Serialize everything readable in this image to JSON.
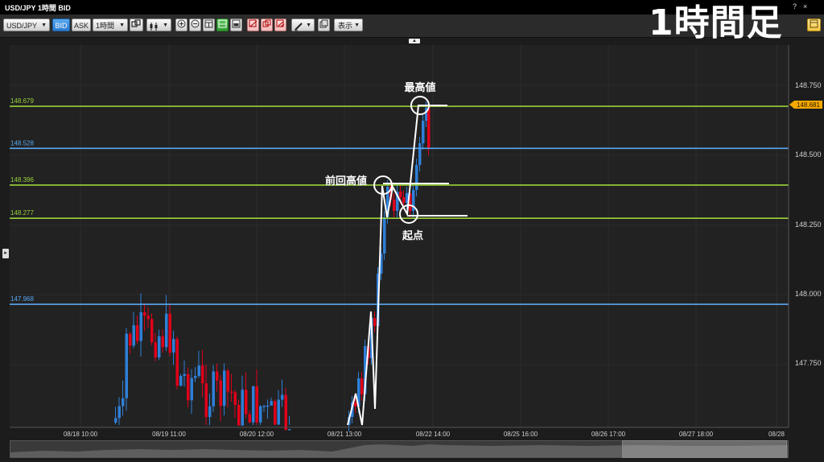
{
  "app": {
    "title": "USD/JPY 1時間 BID",
    "help": "?",
    "close": "×"
  },
  "overlay_title": "1時間足",
  "toolbar": {
    "symbol": "USD/JPY",
    "bid": "BID",
    "ask": "ASK",
    "timeframe": "1時間",
    "display": "表示",
    "dropdown_caret": "▼"
  },
  "handles": {
    "collapse": "▲",
    "side": "▸"
  },
  "colors": {
    "background": "#1c1c1c",
    "grid": "#2c2c2c",
    "green_line": "#9ad23b",
    "blue_line": "#59a8f2",
    "up_candle": "#2f7fd8",
    "down_candle": "#e0001a",
    "current_price_tag": "#f6a800",
    "annotation": "#ffffff"
  },
  "price_axis": {
    "ticks": [
      "148.750",
      "148.500",
      "148.250",
      "148.000",
      "147.750"
    ]
  },
  "time_axis": {
    "ticks": [
      "08/18 10:00",
      "08/19 11:00",
      "08/20 12:00",
      "08/21 13:00",
      "08/22 14:00",
      "08/25 16:00",
      "08/26 17:00",
      "08/27 18:00",
      "08/28"
    ]
  },
  "hlines": [
    {
      "label": "148.679",
      "price": 148.679,
      "color": "green"
    },
    {
      "label": "148.528",
      "price": 148.528,
      "color": "blue"
    },
    {
      "label": "148.396",
      "price": 148.396,
      "color": "green"
    },
    {
      "label": "148.277",
      "price": 148.277,
      "color": "green"
    },
    {
      "label": "147.968",
      "price": 147.968,
      "color": "blue"
    }
  ],
  "current_price": "148.681",
  "annotations": {
    "highest": "最高値",
    "previous_high": "前回高値",
    "starting_point": "起点"
  }
}
